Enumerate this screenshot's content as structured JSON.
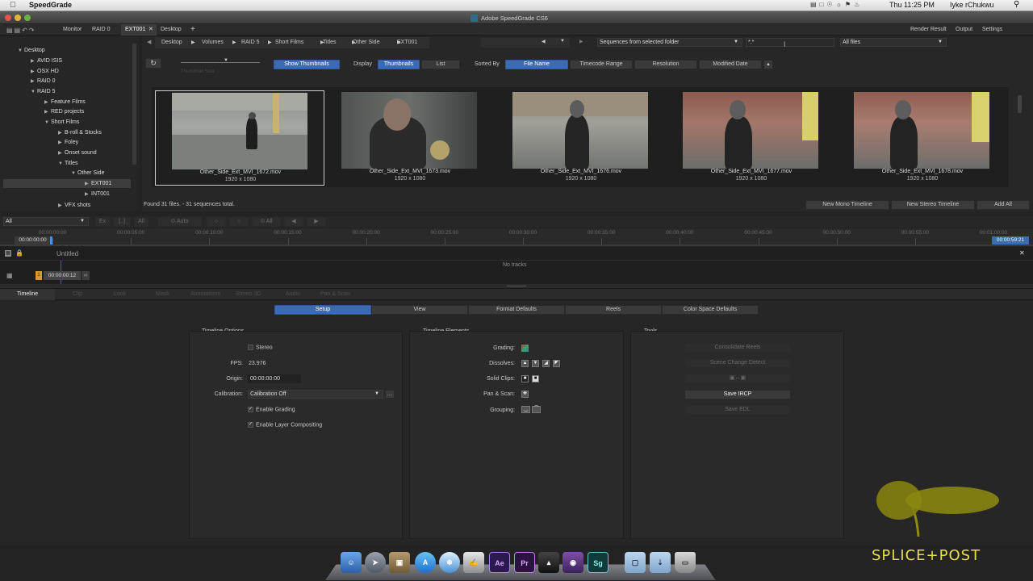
{
  "menubar": {
    "app_name": "SpeedGrade",
    "clock": "Thu 11:25 PM",
    "user": "Iyke rChukwu"
  },
  "window": {
    "title": "Adobe SpeedGrade CS6"
  },
  "tabbar": {
    "monitor": "Monitor",
    "raid0": "RAID 0",
    "ext001": "EXT001",
    "desktop": "Desktop",
    "render_result": "Render Result",
    "output": "Output",
    "settings": "Settings"
  },
  "tree": {
    "items": [
      "Desktop",
      "AVID ISIS",
      "OSX HD",
      "RAID 0",
      "RAID 5",
      "Feature Films",
      "RED projects",
      "Short Films",
      "B-roll & Stocks",
      "Foley",
      "Onset sound",
      "Titles",
      "Other Side",
      "EXT001",
      "INT001",
      "VFX shots"
    ]
  },
  "path": {
    "crumbs": [
      "Desktop",
      "Volumes",
      "RAID 5",
      "Short Films",
      "Titles",
      "Other Side",
      "EXT001"
    ],
    "sequence_source": "Sequences from selected folder",
    "filter": "*.*",
    "file_type": "All files"
  },
  "toolbar": {
    "show_thumbnails": "Show Thumbnails",
    "display_label": "Display",
    "thumbnails": "Thumbnails",
    "list": "List",
    "sorted_by": "Sorted By",
    "file_name": "File Name",
    "timecode_range": "Timecode Range",
    "resolution": "Resolution",
    "modified_date": "Modified Date",
    "thumbnail_size": "Thumbnail Size"
  },
  "thumbnails": [
    {
      "name": "Other_Side_Ext_MVI_1672.mov",
      "res": "1920 x 1080"
    },
    {
      "name": "Other_Side_Ext_MVI_1673.mov",
      "res": "1920 x 1080"
    },
    {
      "name": "Other_Side_Ext_MVI_1676.mov",
      "res": "1920 x 1080"
    },
    {
      "name": "Other_Side_Ext_MVI_1677.mov",
      "res": "1920 x 1080"
    },
    {
      "name": "Other_Side_Ext_MVI_1678.mov",
      "res": "1920 x 1080"
    }
  ],
  "browser_footer": {
    "status": "Found 31 files. - 31 sequences total.",
    "new_mono": "New Mono Timeline",
    "new_stereo": "New Stereo Timeline",
    "add_all": "Add All"
  },
  "timeline_ctrl": {
    "filter": "All",
    "b_ex": "Ex",
    "b_dots": "[..]",
    "b_all": "All",
    "b_auto": "⊙ Auto",
    "b_all2": "⊙ All"
  },
  "ruler": {
    "start": "00:00:00:00",
    "end": "00:00:59:21",
    "ticks": [
      "00:00:00:00",
      "00:00:05:00",
      "00:00:10:00",
      "00:00:15:00",
      "00:00:20:00",
      "00:00:25:00",
      "00:00:30:00",
      "00:00:35:00",
      "00:00:40:00",
      "00:00:45:00",
      "00:00:50:00",
      "00:00:55:00",
      "00:01:00:00"
    ]
  },
  "tracks": {
    "title": "Untitled",
    "empty": "No tracks",
    "position": "00:00:00:12"
  },
  "panel_tabs": [
    "Timeline",
    "Clip",
    "Look",
    "Mask",
    "Annotations",
    "Stereo 3D",
    "Audio",
    "Pan & Scan"
  ],
  "subtabs": [
    "Setup",
    "View",
    "Format Defaults",
    "Reels",
    "Color Space Defaults"
  ],
  "options": {
    "heading": "Timeline Options",
    "stereo": "Stereo",
    "fps_label": "FPS:",
    "fps": "23.976",
    "origin_label": "Origin:",
    "origin": "00:00:00:00",
    "calibration_label": "Calibration:",
    "calibration": "Calibration Off",
    "enable_grading": "Enable Grading",
    "enable_layer": "Enable Layer Compositing"
  },
  "elements": {
    "heading": "Timeline Elements",
    "grading": "Grading:",
    "dissolves": "Dissolves:",
    "solid_clips": "Solid Clips:",
    "pan_scan": "Pan & Scan:",
    "grouping": "Grouping:"
  },
  "tools": {
    "heading": "Tools",
    "consolidate": "Consolidate Reels",
    "scene_change": "Scene Change Detect",
    "save_ircp": "Save IRCP",
    "save_edl": "Save EDL"
  },
  "watermark": {
    "text": "SPLICE+POST"
  },
  "dock": {
    "ae": "Ae",
    "pr": "Pr",
    "sg": "Sg"
  }
}
